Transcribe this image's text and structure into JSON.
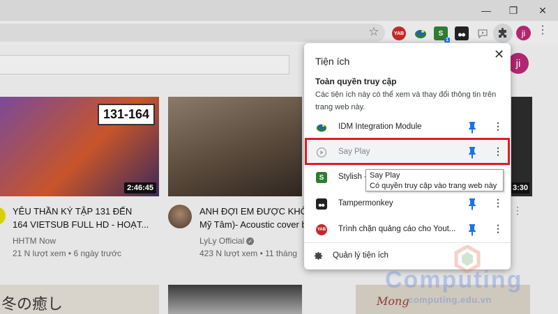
{
  "window": {
    "minimize": "—",
    "restore": "❐",
    "close": "✕"
  },
  "toolbar": {
    "bookmark_icon": "star-icon",
    "extension_icons": [
      "yab-icon",
      "idm-icon",
      "stylish-icon",
      "tampermonkey-icon",
      "say-play-icon"
    ],
    "stylish_badge": "1",
    "profile_initials": "ji",
    "menu": "⋮"
  },
  "youtube": {
    "avatar_initials": "ji",
    "videos": [
      {
        "thumb_badge": "131-164",
        "duration": "2:46:45",
        "title_line1": "YÊU THẦN KÝ TẬP 131 ĐẾN",
        "title_line2": "164 VIETSUB FULL HD - HOẠT...",
        "channel": "HHTM Now",
        "meta": "21 N lượt xem • 6 ngày trước"
      },
      {
        "duration": "",
        "title_line1": "ANH ĐỢI EM ĐƯỢC KHÔN",
        "title_line2": "Mỹ Tâm)- Acoustic cover b",
        "channel": "LyLy Official",
        "meta": "423 N lượt xem • 11 tháng"
      },
      {
        "duration": "3:30"
      }
    ],
    "row2": {
      "left_text": "冬の癒し",
      "right_text": "Mong"
    }
  },
  "popup": {
    "title": "Tiện ích",
    "close": "✕",
    "section_title": "Toàn quyền truy cập",
    "section_desc": "Các tiện ích này có thể xem và thay đổi thông tin trên trang web này.",
    "extensions": [
      {
        "label": "IDM Integration Module",
        "pinned": true
      },
      {
        "label": "Say Play",
        "pinned": true
      },
      {
        "label": "Stylish -",
        "pinned": true
      },
      {
        "label": "Tampermonkey",
        "pinned": true
      },
      {
        "label": "Trình chặn quảng cáo cho Yout...",
        "pinned": true
      }
    ],
    "manage_label": "Quản lý tiện ích",
    "more": "⋮"
  },
  "tooltip": {
    "title": "Say Play",
    "desc": "Có quyền truy cập vào trang web này"
  },
  "watermark": {
    "text": "Computing",
    "sub": "computing.edu.vn"
  },
  "colors": {
    "highlight": "#e0192c",
    "pin": "#1a73e8",
    "avatar": "#b0266f"
  }
}
